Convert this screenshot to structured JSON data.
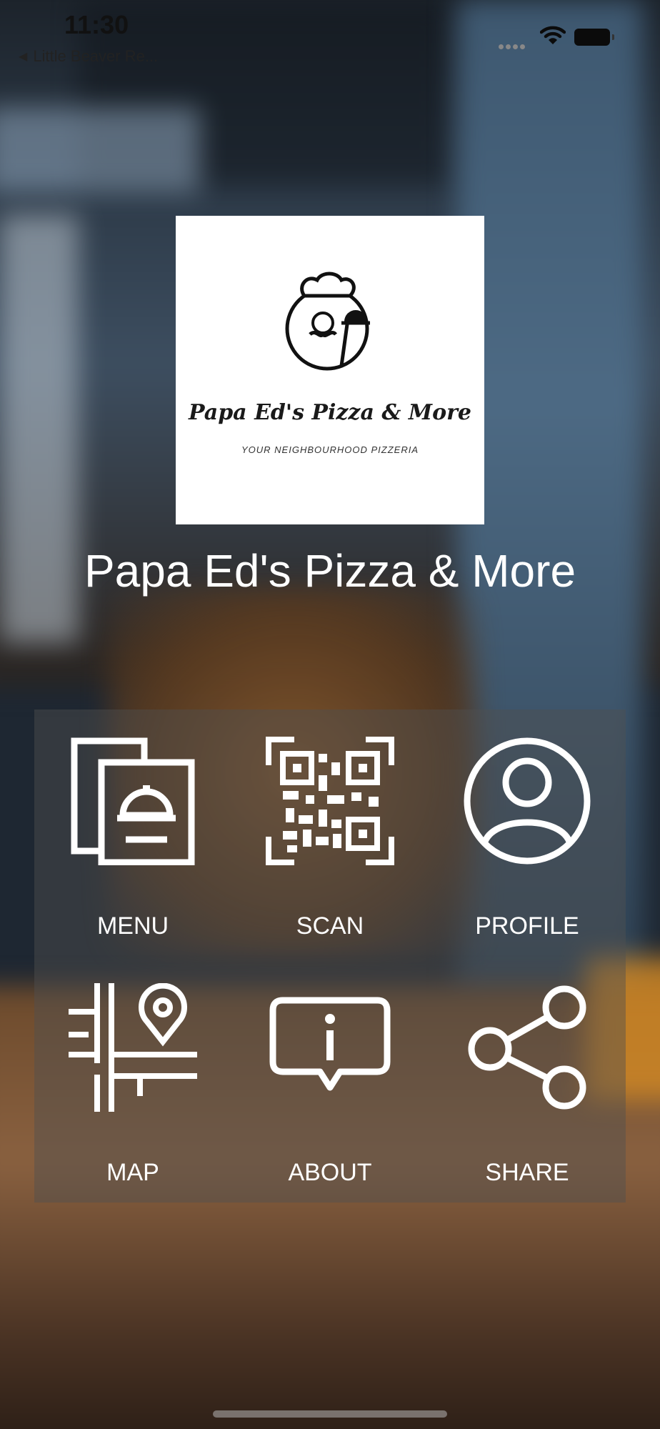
{
  "status_bar": {
    "time": "11:30",
    "back_app": "Little Beaver Re...",
    "icons": [
      "cellular-dots-icon",
      "wifi-icon",
      "battery-icon"
    ]
  },
  "logo": {
    "name": "Papa Ed's Pizza & More",
    "tagline": "YOUR NEIGHBOURHOOD PIZZERIA",
    "icon": "chef-serving-cloche-icon"
  },
  "restaurant_title": "Papa Ed's Pizza & More",
  "actions": [
    {
      "label": "MENU",
      "icon": "menu-cloche-icon"
    },
    {
      "label": "SCAN",
      "icon": "qr-code-icon"
    },
    {
      "label": "PROFILE",
      "icon": "user-circle-icon"
    },
    {
      "label": "MAP",
      "icon": "map-pin-icon"
    },
    {
      "label": "ABOUT",
      "icon": "info-bubble-icon"
    },
    {
      "label": "SHARE",
      "icon": "share-icon"
    }
  ],
  "colors": {
    "text": "#ffffff",
    "panel": "rgba(80,80,80,0.45)",
    "logo_bg": "#ffffff"
  }
}
